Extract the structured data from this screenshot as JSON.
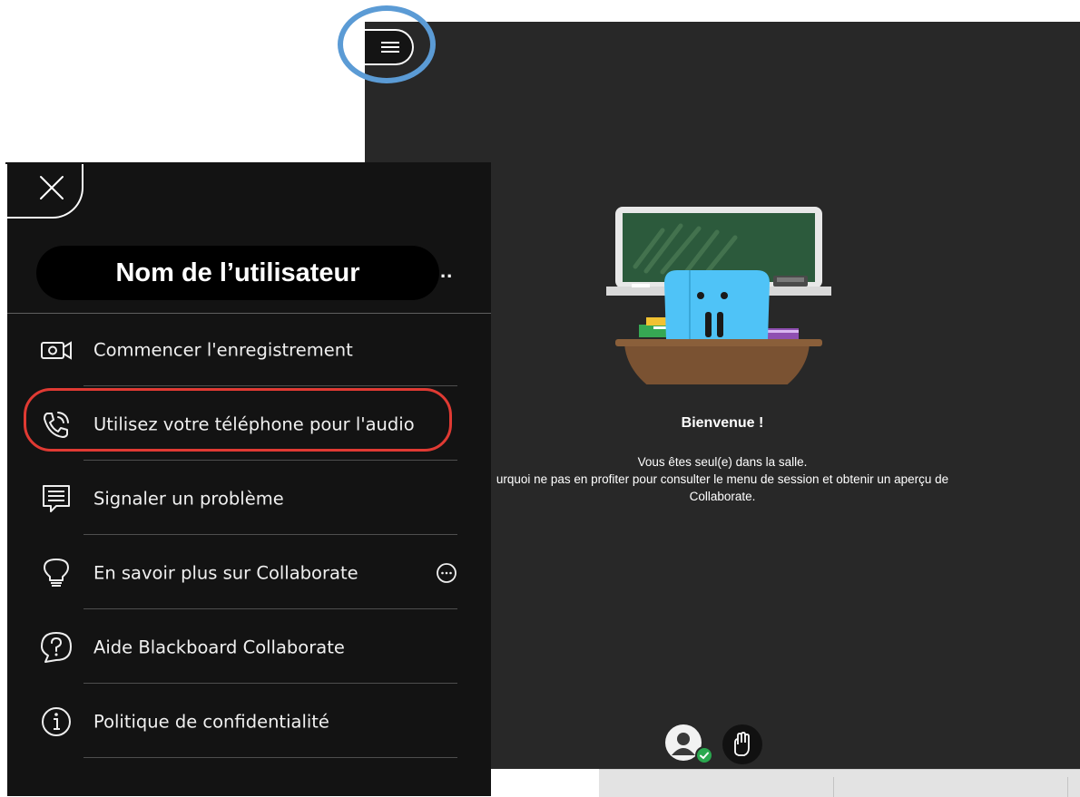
{
  "session": {
    "menu_button_icon": "hamburger-menu-icon",
    "welcome_title": "Bienvenue !",
    "welcome_lines": [
      "Vous êtes seul(e) dans la salle.",
      "urquoi ne pas en profiter pour consulter le menu de session et obtenir un aperçu de",
      "Collaborate."
    ],
    "illustration": "classroom-chalkboard-illustration",
    "bottom_controls": {
      "avatar_icon": "user-avatar-icon",
      "status_icon": "checkmark-icon",
      "hand_icon": "raise-hand-icon"
    }
  },
  "panel": {
    "close_icon": "close-icon",
    "user_name": "Nom de l’utilisateur",
    "user_ellipsis": "..",
    "items": [
      {
        "label": "Commencer l'enregistrement",
        "icon": "video-camera-icon"
      },
      {
        "label": "Utilisez votre téléphone pour l'audio",
        "icon": "phone-icon"
      },
      {
        "label": "Signaler un problème",
        "icon": "report-message-icon"
      },
      {
        "label": "En savoir plus sur Collaborate",
        "icon": "lightbulb-icon",
        "extra_icon": "more-options-icon"
      },
      {
        "label": "Aide Blackboard Collaborate",
        "icon": "help-question-icon"
      },
      {
        "label": "Politique de confidentialité",
        "icon": "info-icon"
      }
    ]
  },
  "colors": {
    "session_background": "#282828",
    "panel_background": "#131313",
    "highlight_blue": "#5b9bd5",
    "highlight_red": "#e03a33",
    "status_green": "#2aa84f"
  }
}
